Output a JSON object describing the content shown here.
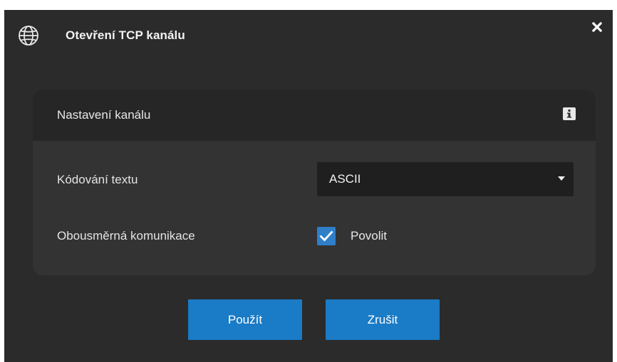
{
  "dialog": {
    "title": "Otevření TCP kanálu",
    "title_icon": "globe-icon",
    "close_icon": "close-icon"
  },
  "panel": {
    "header": "Nastavení kanálu",
    "header_icon": "info-icon",
    "encoding_label": "Kódování textu",
    "encoding_value": "ASCII",
    "bidirectional_label": "Obousměrná komunikace",
    "bidirectional_checked": true,
    "bidirectional_checkbox_label": "Povolit"
  },
  "buttons": {
    "apply_label": "Použít",
    "cancel_label": "Zrušit"
  },
  "colors": {
    "dialog_background": "#2b2b2b",
    "panel_background": "#333333",
    "panel_header_background": "#262626",
    "select_background": "#1f1f1f",
    "accent": "#1a7bc6",
    "checkbox": "#2f7fc8"
  }
}
